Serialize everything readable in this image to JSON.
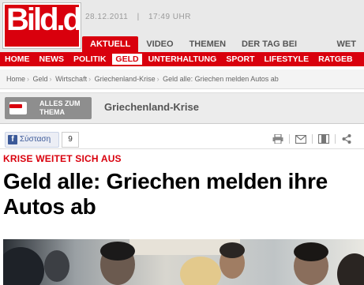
{
  "logo": {
    "text": "Bild.de"
  },
  "datebar": {
    "date": "28.12.2011",
    "separator": "|",
    "time": "17:49 UHR"
  },
  "top_tabs": [
    "AKTUELL",
    "VIDEO",
    "THEMEN",
    "DER TAG BEI BILD.DE",
    "WET"
  ],
  "main_nav": [
    "HOME",
    "NEWS",
    "POLITIK",
    "GELD",
    "UNTERHALTUNG",
    "SPORT",
    "LIFESTYLE",
    "RATGEB"
  ],
  "breadcrumb": [
    "Home",
    "Geld",
    "Wirtschaft",
    "Griechenland-Krise",
    "Geld alle: Griechen melden Autos ab"
  ],
  "theme": {
    "button_label": "ALLES ZUM\nTHEMA",
    "title": "Griechenland-Krise"
  },
  "social": {
    "fb_label": "Σύσταση",
    "fb_count": "9"
  },
  "article": {
    "kicker": "KRISE WEITET SICH AUS",
    "headline": "Geld alle: Griechen melden ihre Autos ab"
  },
  "colors": {
    "brand_red": "#d9000d",
    "facebook_blue": "#3b5998"
  },
  "icons": [
    "print-icon",
    "email-icon",
    "bookmark-icon",
    "share-icon"
  ]
}
